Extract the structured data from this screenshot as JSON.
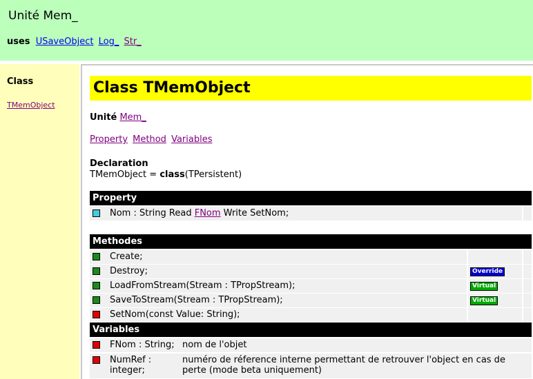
{
  "header": {
    "unit_title": "Unité Mem_",
    "uses_label": "uses",
    "uses_links": [
      "USaveObject",
      "Log_",
      "Str_"
    ]
  },
  "sidebar": {
    "heading": "Class",
    "links": [
      "TMemObject"
    ]
  },
  "main": {
    "class_title": "Class TMemObject",
    "unite_label": "Unité",
    "unite_link": "Mem_",
    "nav_links": [
      "Property",
      "Method",
      "Variables"
    ],
    "declaration_label": "Declaration",
    "declaration_prefix": "TMemObject = ",
    "declaration_keyword": "class",
    "declaration_suffix": "(TPersistent)",
    "property_heading": "Property",
    "property": {
      "prefix": "Nom : String Read ",
      "link": "FNom",
      "suffix": " Write SetNom;",
      "icon_color": "#44ccdd"
    },
    "methods_heading": "Methodes",
    "methods": [
      {
        "text": "Create;",
        "icon_color": "#1a8a1a",
        "badge": "",
        "badge_color": ""
      },
      {
        "text": "Destroy;",
        "icon_color": "#1a8a1a",
        "badge": "Override",
        "badge_color": "#0000cc"
      },
      {
        "text": "LoadFromStream(Stream : TPropStream);",
        "icon_color": "#1a8a1a",
        "badge": "Virtual",
        "badge_color": "#00aa00"
      },
      {
        "text": "SaveToStream(Stream : TPropStream);",
        "icon_color": "#1a8a1a",
        "badge": "Virtual",
        "badge_color": "#00aa00"
      },
      {
        "text": "SetNom(const Value: String);",
        "icon_color": "#e00000",
        "badge": "",
        "badge_color": ""
      }
    ],
    "variables_heading": "Variables",
    "variables": [
      {
        "name": "FNom : String;",
        "desc": "nom de l'objet"
      },
      {
        "name": "NumRef : integer;",
        "desc": "numéro de réference interne permettant de retrouver l'object en cas de perte (mode beta uniquement)"
      }
    ]
  }
}
